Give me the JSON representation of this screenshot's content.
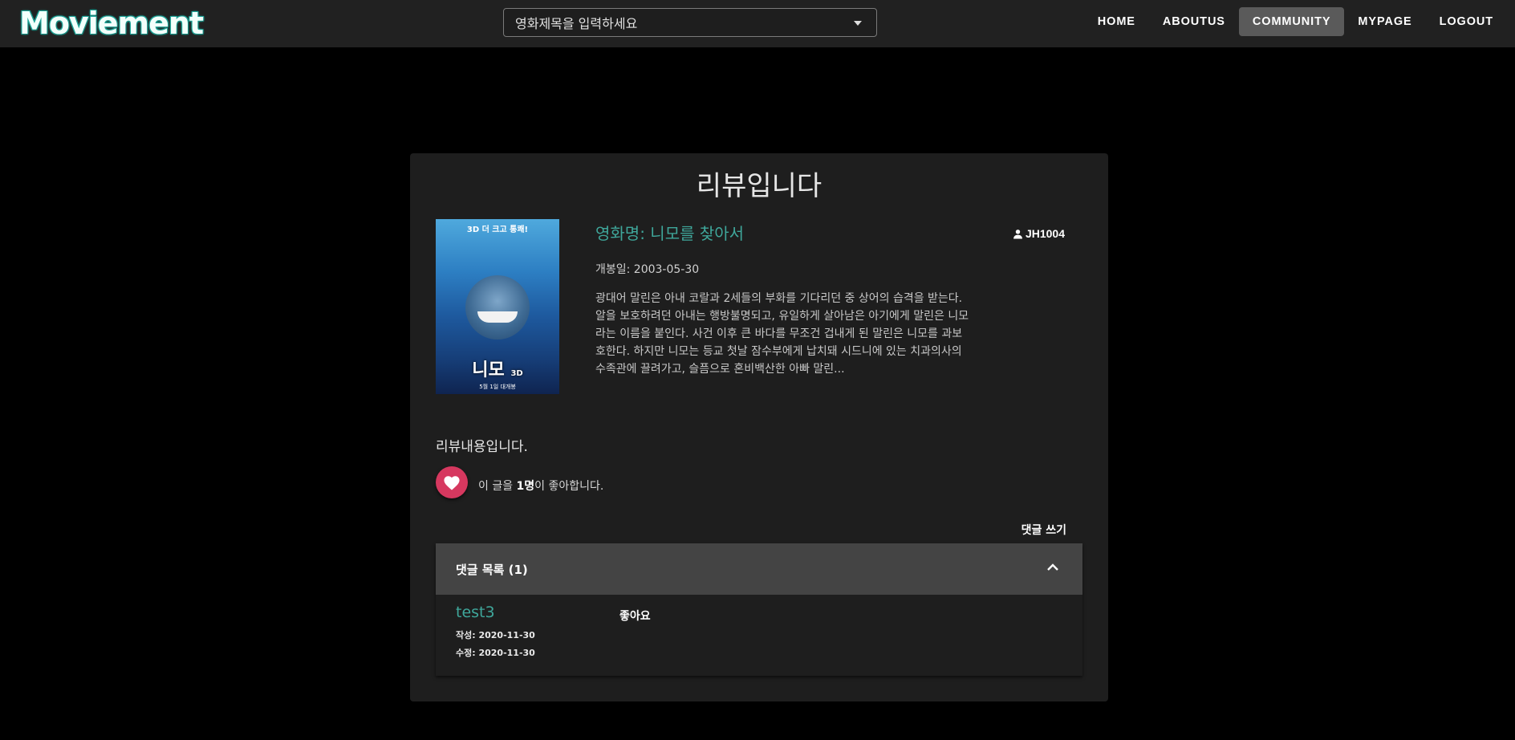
{
  "app": {
    "logo": "Moviement",
    "search_placeholder": "영화제목을 입력하세요"
  },
  "nav": [
    {
      "label": "HOME",
      "active": false
    },
    {
      "label": "ABOUTUS",
      "active": false
    },
    {
      "label": "COMMUNITY",
      "active": true
    },
    {
      "label": "MYPAGE",
      "active": false
    },
    {
      "label": "LOGOUT",
      "active": false
    }
  ],
  "review": {
    "title": "리뷰입니다",
    "movie_name": "영화명: 니모를 찾아서",
    "author": "JH1004",
    "release": "개봉일: 2003-05-30",
    "synopsis": "광대어 말린은 아내 코랄과 2세들의 부화를 기다리던 중 상어의 습격을 받는다. 알을 보호하려던 아내는 행방불명되고, 유일하게 살아남은 아기에게 말린은 니모라는 이름을 붙인다. 사건 이후 큰 바다를 무조건 겁내게 된 말린은 니모를 과보호한다. 하지만 니모는 등교 첫날 잠수부에게 납치돼 시드니에 있는 치과의사의 수족관에 끌려가고, 슬픔으로 혼비백산한 아빠 말린...",
    "content": "리뷰내용입니다.",
    "poster": {
      "top_text": "3D 더 크고 통쾌!",
      "title_text": "니모",
      "sub_text": "3D",
      "date_text": "5월 1일 대개봉"
    },
    "likes": {
      "prefix": "이 글을 ",
      "count": "1명",
      "suffix": "이 좋아합니다."
    },
    "write_comment": "댓글 쓰기"
  },
  "comments": {
    "header": "댓글 목록 (1)",
    "items": [
      {
        "author": "test3",
        "created": "작성: 2020-11-30",
        "modified": "수정: 2020-11-30",
        "text": "좋아요"
      }
    ]
  },
  "colors": {
    "accent": "#3fa79b",
    "like": "#d6385f",
    "appbar": "#212121",
    "card": "#1e1e1e"
  }
}
